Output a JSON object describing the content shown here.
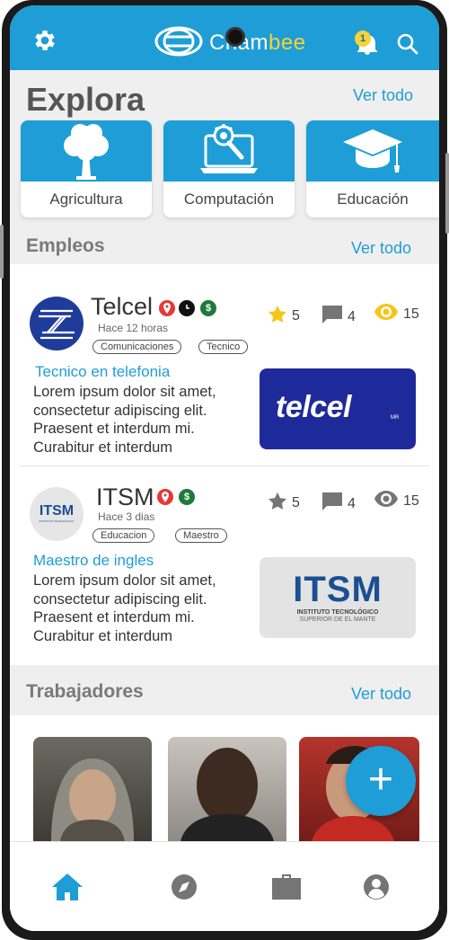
{
  "header": {
    "logo_text_main": "Cham",
    "logo_text_accent": "bee",
    "notification_count": "1",
    "icons": [
      "gear-icon",
      "hive-logo-icon",
      "bell-icon",
      "search-icon"
    ],
    "colors": {
      "primary": "#1e9dd6",
      "accent": "#f6d23a"
    }
  },
  "explora": {
    "title": "Explora",
    "ver_todo": "Ver todo",
    "categories": [
      {
        "label": "Agricultura",
        "icon": "tree-icon"
      },
      {
        "label": "Computación",
        "icon": "laptop-gear-icon"
      },
      {
        "label": "Educación",
        "icon": "graduation-cap-icon"
      }
    ]
  },
  "empleos": {
    "title": "Empleos",
    "ver_todo": "Ver todo",
    "jobs": [
      {
        "company": "Telcel",
        "time": "Hace 12 horas",
        "tags": [
          "Comunicaciones",
          "Tecnico"
        ],
        "badges": [
          "location-pin-icon",
          "clock-icon",
          "dollar-icon"
        ],
        "rating": "5",
        "comments": "4",
        "views": "15",
        "title": "Tecnico en telefonia",
        "description": "Lorem ipsum dolor sit amet,\n consectetur adipiscing elit.\nPraesent et interdum mi.\nCurabitur et interdum",
        "image_text": "telcel",
        "image_sup": "MR"
      },
      {
        "company": "ITSM",
        "time": "Hace 3 dias",
        "tags": [
          "Educacion",
          "Maestro"
        ],
        "badges": [
          "location-pin-icon",
          "dollar-icon"
        ],
        "rating": "5",
        "comments": "4",
        "views": "15",
        "title": "Maestro de ingles",
        "description": "Lorem ipsum dolor sit amet,\n consectetur adipiscing elit.\nPraesent et interdum mi.\nCurabitur et interdum",
        "image_text": "ITSM",
        "image_sub1": "INSTITUTO TECNOLÓGICO",
        "image_sub2": "SUPERIOR DE EL MANTE",
        "avatar_text": "ITSM",
        "avatar_sub": "INSTITUTO TECNOLÓGICO"
      }
    ]
  },
  "trabajadores": {
    "title": "Trabajadores",
    "ver_todo": "Ver todo"
  },
  "fab": {
    "label": "+"
  },
  "bottom_nav": {
    "items": [
      "home-icon",
      "compass-icon",
      "briefcase-icon",
      "profile-icon"
    ],
    "active": "home-icon"
  }
}
